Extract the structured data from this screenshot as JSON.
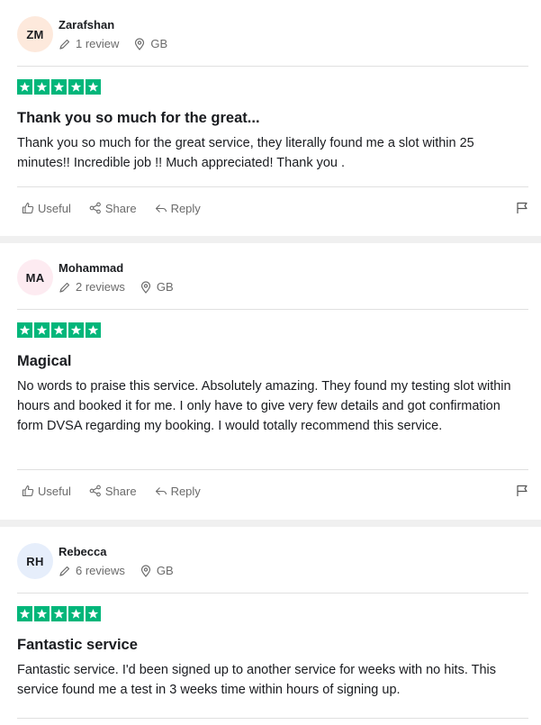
{
  "colors": {
    "star_bg": "#00b67a",
    "separator": "#f0f0f0"
  },
  "actions": {
    "useful": "Useful",
    "share": "Share",
    "reply": "Reply"
  },
  "reviews": [
    {
      "initials": "ZM",
      "avatar_color": "#fde9dc",
      "name": "Zarafshan",
      "review_count": "1 review",
      "country": "GB",
      "rating": 5,
      "title": "Thank you so much for the great...",
      "body": "Thank you so much for the great service, they literally found me a slot within 25 minutes!! Incredible job !! Much appreciated! Thank you ."
    },
    {
      "initials": "MA",
      "avatar_color": "#fdebf1",
      "name": "Mohammad",
      "review_count": "2 reviews",
      "country": "GB",
      "rating": 5,
      "title": "Magical",
      "body": "No words to praise this service. Absolutely amazing. They found my testing slot within hours and booked it for me. I only have to give very few details and got confirmation form DVSA regarding my booking. I would totally recommend this service."
    },
    {
      "initials": "RH",
      "avatar_color": "#e6eefb",
      "name": "Rebecca",
      "review_count": "6 reviews",
      "country": "GB",
      "rating": 5,
      "title": "Fantastic service",
      "body": "Fantastic service. I'd been signed up to another service for weeks with no hits. This service found me a test in 3 weeks time within hours of signing up."
    }
  ]
}
